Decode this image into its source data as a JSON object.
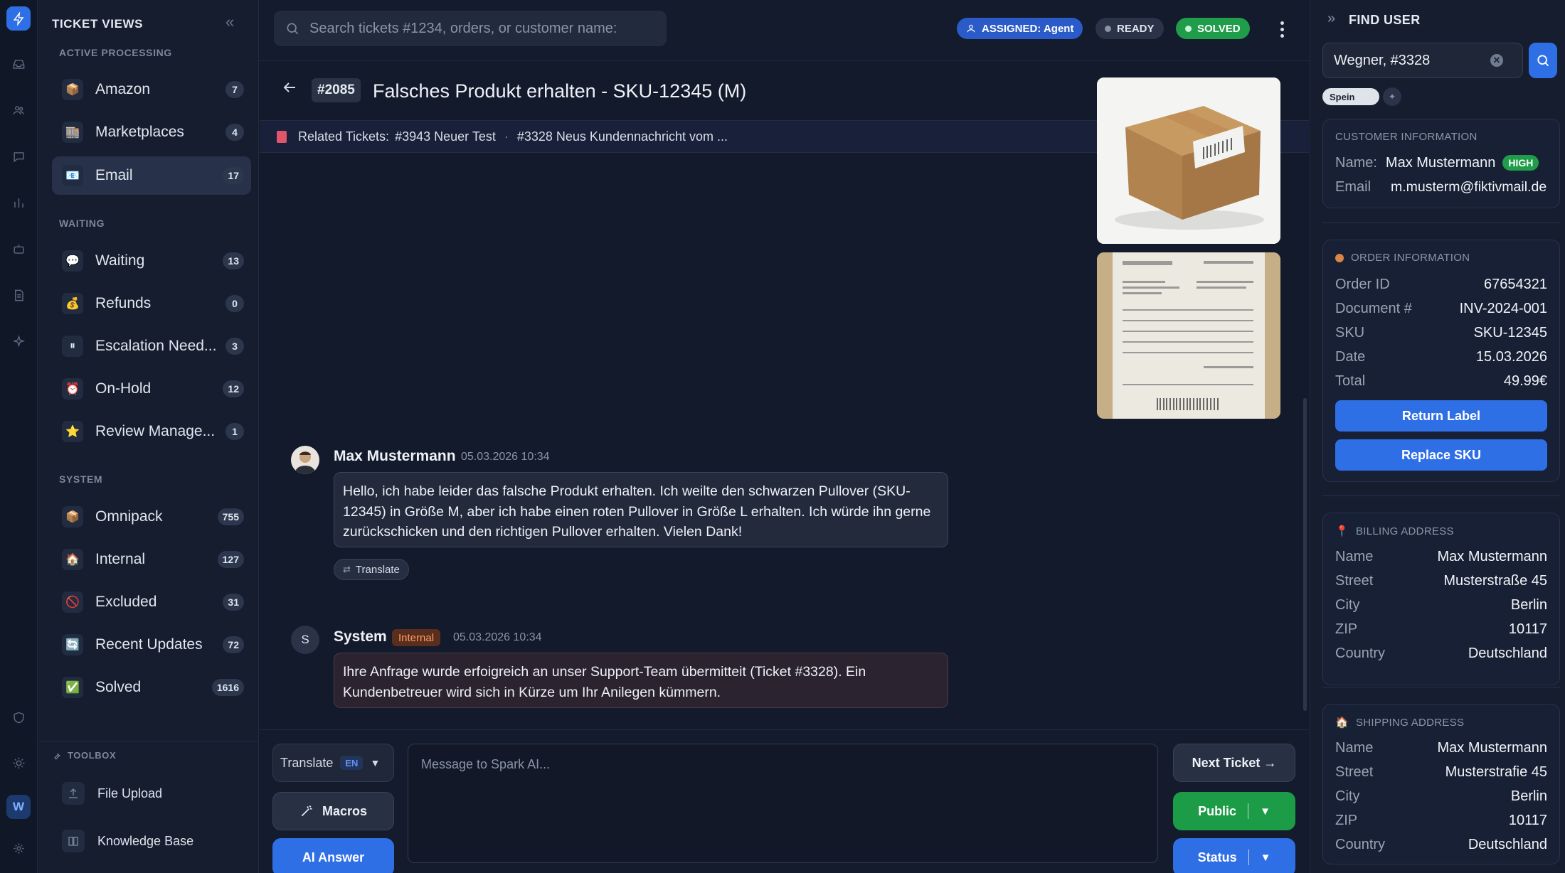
{
  "sidebar": {
    "title": "TICKET VIEWS",
    "sections": {
      "active": "ACTIVE PROCESSING",
      "waiting": "WAITING",
      "system": "SYSTEM"
    },
    "items": [
      {
        "label": "Amazon",
        "count": "7",
        "icon": "📦"
      },
      {
        "label": "Marketplaces",
        "count": "4",
        "icon": "🏬"
      },
      {
        "label": "Email",
        "count": "17",
        "icon": "📧"
      },
      {
        "label": "Waiting",
        "count": "13",
        "icon": "💬"
      },
      {
        "label": "Refunds",
        "count": "0",
        "icon": "💰"
      },
      {
        "label": "Escalation Need...",
        "count": "3",
        "icon": "⏸"
      },
      {
        "label": "On-Hold",
        "count": "12",
        "icon": "⏰"
      },
      {
        "label": "Review Manage...",
        "count": "1",
        "icon": "⭐"
      },
      {
        "label": "Omnipack",
        "count": "755",
        "icon": "📦"
      },
      {
        "label": "Internal",
        "count": "127",
        "icon": "🏠"
      },
      {
        "label": "Excluded",
        "count": "31",
        "icon": "🚫"
      },
      {
        "label": "Recent Updates",
        "count": "72",
        "icon": "🔄"
      },
      {
        "label": "Solved",
        "count": "1616",
        "icon": "✅"
      }
    ],
    "toolbox": {
      "title": "TOOLBOX",
      "items": [
        "File Upload",
        "Knowledge Base"
      ]
    }
  },
  "rail": {
    "user_initial": "W"
  },
  "topbar": {
    "search_placeholder": "Search tickets #1234, orders, or customer name:",
    "assigned": "ASSIGNED: Agent",
    "ready": "READY",
    "solved": "SOLVED"
  },
  "ticket": {
    "id": "#2085",
    "title": "Falsches Produkt erhalten - SKU-12345 (M)",
    "related_label": "Related Tickets:",
    "related": [
      "#3943 Neuer Test",
      "#3328 Neus Kundennachricht vom ..."
    ],
    "separator": "·"
  },
  "messages": [
    {
      "author": "Max Mustermann",
      "time": "05.03.2026 10:34",
      "text": "Hello, ich habe leider das falsche Produkt erhalten. Ich weilte den schwarzen Pullover (SKU-12345) in Größe M, aber ich habe einen roten Pullover in Größe L erhalten. Ich würde ihn gerne zurückschicken und den richtigen Pullover erhalten. Vielen Dank!",
      "action": "Translate"
    },
    {
      "author": "System",
      "initial": "S",
      "badge": "Internal",
      "time": "05.03.2026 10:34",
      "text": "Ihre Anfrage wurde erfoigreich an unser Support-Team übermitteit (Ticket #3328). Ein Kundenbetreuer wird sich in Kürze um Ihr Anilegen kümmern."
    }
  ],
  "composer": {
    "translate": "Translate",
    "lang": "EN",
    "macros": "Macros",
    "ai_answer": "AI Answer",
    "placeholder": "Message to Spark AI...",
    "next": "Next Ticket →",
    "public": "Public",
    "status": "Status"
  },
  "right": {
    "title": "FIND USER",
    "query": "Wegner, #3328",
    "chip": "Spein",
    "customer": {
      "title": "CUSTOMER INFORMATION",
      "name_label": "Name:",
      "name": "Max Mustermann",
      "priority": "HIGH",
      "email_label": "Email",
      "email": "m.musterm@fiktivmail.de"
    },
    "order": {
      "title": "ORDER INFORMATION",
      "rows": [
        {
          "k": "Order ID",
          "v": "67654321"
        },
        {
          "k": "Document #",
          "v": "INV-2024-001"
        },
        {
          "k": "SKU",
          "v": "SKU-12345"
        },
        {
          "k": "Date",
          "v": "15.03.2026"
        },
        {
          "k": "Total",
          "v": "49.99€"
        }
      ],
      "return_label": "Return Label",
      "replace_sku": "Replace SKU"
    },
    "billing": {
      "title": "BILLING ADDRESS",
      "rows": [
        {
          "k": "Name",
          "v": "Max Mustermann"
        },
        {
          "k": "Street",
          "v": "Musterstraße 45"
        },
        {
          "k": "City",
          "v": "Berlin"
        },
        {
          "k": "ZIP",
          "v": "10117"
        },
        {
          "k": "Country",
          "v": "Deutschland"
        }
      ]
    },
    "shipping": {
      "title": "SHIPPING ADDRESS",
      "rows": [
        {
          "k": "Name",
          "v": "Max Mustermann"
        },
        {
          "k": "Street",
          "v": "Musterstrafie 45"
        },
        {
          "k": "City",
          "v": "Berlin"
        },
        {
          "k": "ZIP",
          "v": "10117"
        },
        {
          "k": "Country",
          "v": "Deutschland"
        }
      ]
    }
  },
  "colors": {
    "accent": "#2f6fe6",
    "success": "#1f9d4a",
    "background": "#131a2b"
  }
}
